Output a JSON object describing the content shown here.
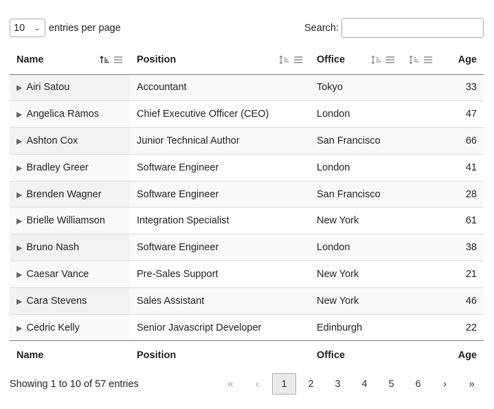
{
  "length": {
    "value": "10",
    "label": "entries per page"
  },
  "search": {
    "label": "Search:",
    "value": ""
  },
  "columns": {
    "name": "Name",
    "position": "Position",
    "office": "Office",
    "blank": "",
    "age": "Age"
  },
  "rows": [
    {
      "name": "Airi Satou",
      "position": "Accountant",
      "office": "Tokyo",
      "age": "33"
    },
    {
      "name": "Angelica Ramos",
      "position": "Chief Executive Officer (CEO)",
      "office": "London",
      "age": "47"
    },
    {
      "name": "Ashton Cox",
      "position": "Junior Technical Author",
      "office": "San Francisco",
      "age": "66"
    },
    {
      "name": "Bradley Greer",
      "position": "Software Engineer",
      "office": "London",
      "age": "41"
    },
    {
      "name": "Brenden Wagner",
      "position": "Software Engineer",
      "office": "San Francisco",
      "age": "28"
    },
    {
      "name": "Brielle Williamson",
      "position": "Integration Specialist",
      "office": "New York",
      "age": "61"
    },
    {
      "name": "Bruno Nash",
      "position": "Software Engineer",
      "office": "London",
      "age": "38"
    },
    {
      "name": "Caesar Vance",
      "position": "Pre-Sales Support",
      "office": "New York",
      "age": "21"
    },
    {
      "name": "Cara Stevens",
      "position": "Sales Assistant",
      "office": "New York",
      "age": "46"
    },
    {
      "name": "Cedric Kelly",
      "position": "Senior Javascript Developer",
      "office": "Edinburgh",
      "age": "22"
    }
  ],
  "info": "Showing 1 to 10 of 57 entries",
  "pagination": {
    "first": "«",
    "prev": "‹",
    "pages": [
      "1",
      "2",
      "3",
      "4",
      "5",
      "6"
    ],
    "current": "1",
    "next": "›",
    "last": "»"
  },
  "icons": {
    "expand": "expand-caret-icon",
    "sort_asc": "sort-ascending-icon",
    "sort_none": "sort-neutral-icon",
    "column_menu": "column-menu-icon"
  }
}
